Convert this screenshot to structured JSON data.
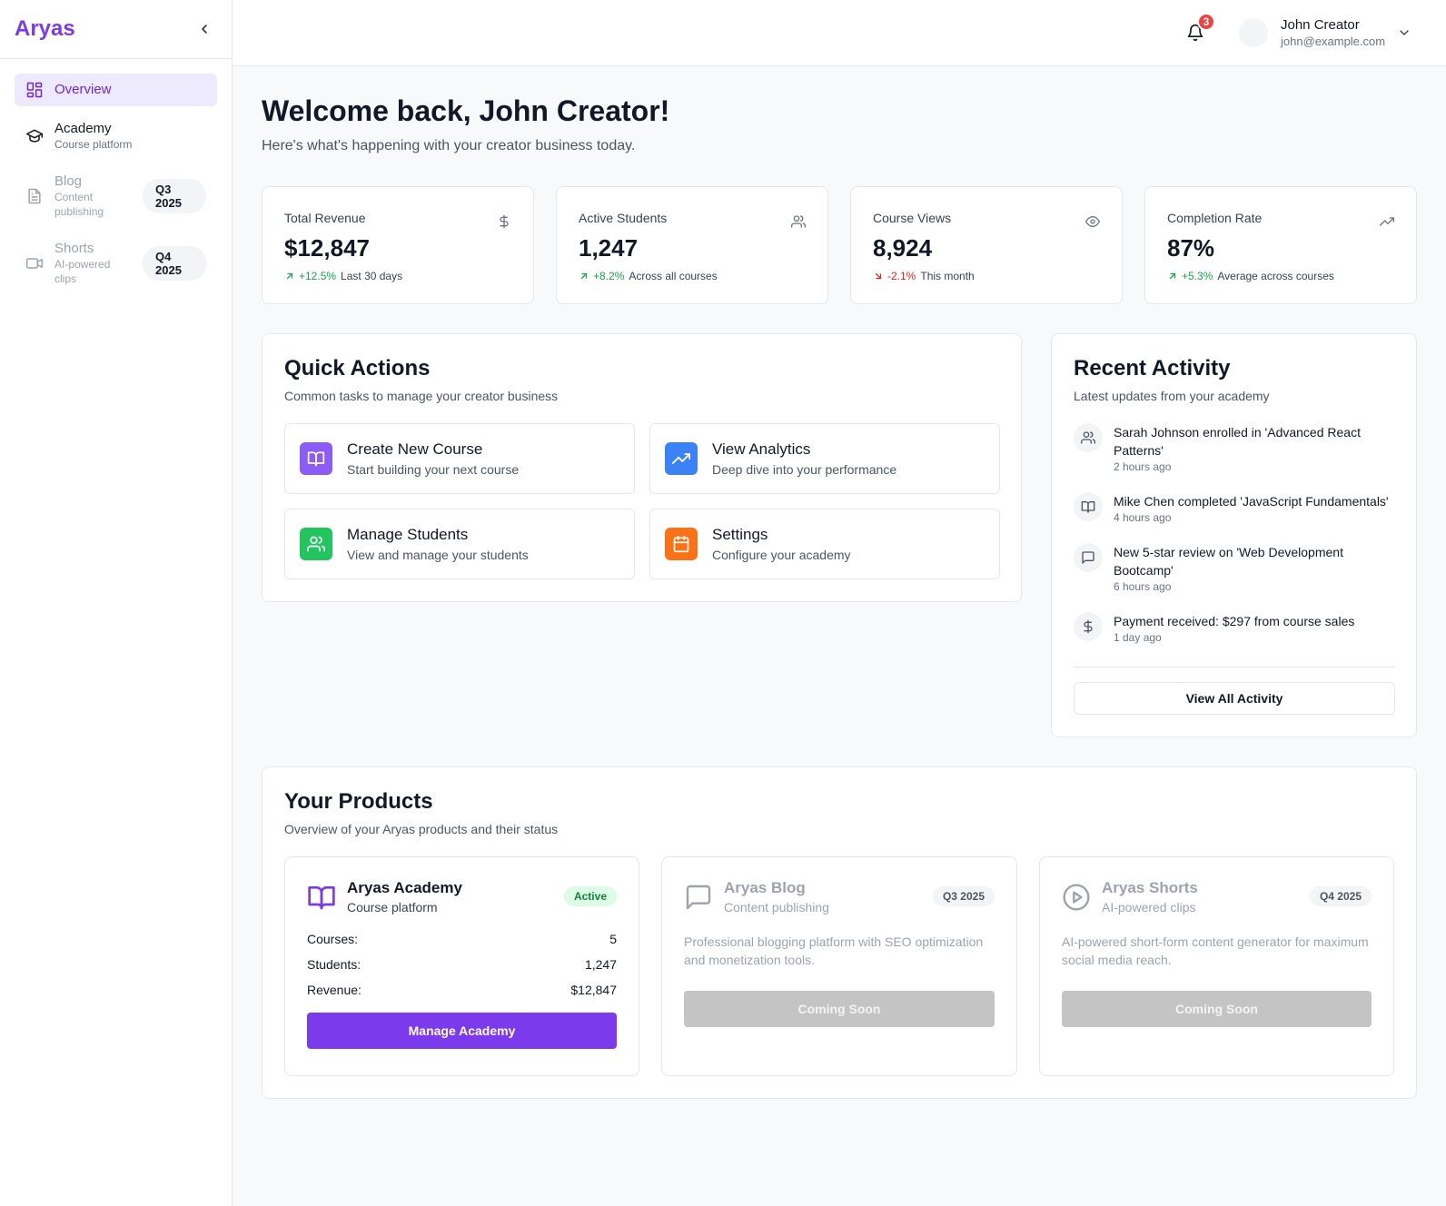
{
  "sidebar": {
    "brand": "Aryas",
    "items": [
      {
        "label": "Overview",
        "sub": "",
        "badge": "",
        "icon": "grid-icon",
        "active": true
      },
      {
        "label": "Academy",
        "sub": "Course platform",
        "badge": "",
        "icon": "graduation-cap-icon"
      },
      {
        "label": "Blog",
        "sub": "Content publishing",
        "badge": "Q3 2025",
        "icon": "document-icon"
      },
      {
        "label": "Shorts",
        "sub": "AI-powered clips",
        "badge": "Q4 2025",
        "icon": "video-icon"
      }
    ]
  },
  "header": {
    "notification_count": "3",
    "user_name": "John Creator",
    "user_email": "john@example.com"
  },
  "main": {
    "welcome_title": "Welcome back, John Creator!",
    "welcome_sub": "Here's what's happening with your creator business today.",
    "stats": [
      {
        "label": "Total Revenue",
        "value": "$12,847",
        "trend": "+12.5%",
        "trend_dir": "up",
        "note": "Last 30 days",
        "icon": "dollar-icon"
      },
      {
        "label": "Active Students",
        "value": "1,247",
        "trend": "+8.2%",
        "trend_dir": "up",
        "note": "Across all courses",
        "icon": "users-icon"
      },
      {
        "label": "Course Views",
        "value": "8,924",
        "trend": "-2.1%",
        "trend_dir": "down",
        "note": "This month",
        "icon": "eye-icon"
      },
      {
        "label": "Completion Rate",
        "value": "87%",
        "trend": "+5.3%",
        "trend_dir": "up",
        "note": "Average across courses",
        "icon": "trending-up-icon"
      }
    ],
    "quick_actions": {
      "title": "Quick Actions",
      "sub": "Common tasks to manage your creator business",
      "items": [
        {
          "title": "Create New Course",
          "desc": "Start building your next course",
          "color": "#8b5cf6",
          "icon": "book-open-icon"
        },
        {
          "title": "View Analytics",
          "desc": "Deep dive into your performance",
          "color": "#3b82f6",
          "icon": "trending-up-icon"
        },
        {
          "title": "Manage Students",
          "desc": "View and manage your students",
          "color": "#22c55e",
          "icon": "users-icon"
        },
        {
          "title": "Settings",
          "desc": "Configure your academy",
          "color": "#f97316",
          "icon": "calendar-icon"
        }
      ]
    },
    "recent_activity": {
      "title": "Recent Activity",
      "sub": "Latest updates from your academy",
      "items": [
        {
          "text": "Sarah Johnson enrolled in 'Advanced React Patterns'",
          "time": "2 hours ago",
          "icon": "users-icon"
        },
        {
          "text": "Mike Chen completed 'JavaScript Fundamentals'",
          "time": "4 hours ago",
          "icon": "book-open-icon"
        },
        {
          "text": "New 5-star review on 'Web Development Bootcamp'",
          "time": "6 hours ago",
          "icon": "message-icon"
        },
        {
          "text": "Payment received: $297 from course sales",
          "time": "1 day ago",
          "icon": "dollar-icon"
        }
      ],
      "button_label": "View All Activity"
    },
    "products": {
      "title": "Your Products",
      "sub": "Overview of your Aryas products and their status",
      "academy": {
        "title": "Aryas Academy",
        "sub": "Course platform",
        "badge": "Active",
        "rows": [
          {
            "label": "Courses:",
            "value": "5"
          },
          {
            "label": "Students:",
            "value": "1,247"
          },
          {
            "label": "Revenue:",
            "value": "$12,847"
          }
        ],
        "button_label": "Manage Academy"
      },
      "blog": {
        "title": "Aryas Blog",
        "sub": "Content publishing",
        "badge": "Q3 2025",
        "desc": "Professional blogging platform with SEO optimization and monetization tools.",
        "button_label": "Coming Soon"
      },
      "shorts": {
        "title": "Aryas Shorts",
        "sub": "AI-powered clips",
        "badge": "Q4 2025",
        "desc": "AI-powered short-form content generator for maximum social media reach.",
        "button_label": "Coming Soon"
      }
    }
  },
  "colors": {
    "brand": "#7c3aed",
    "trend_up": "#16a34a",
    "trend_down": "#dc2626"
  }
}
